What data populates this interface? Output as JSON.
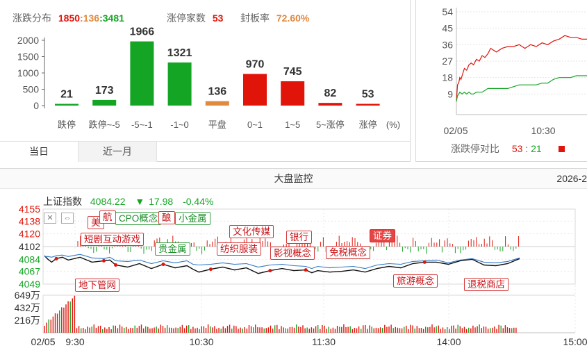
{
  "breadth": {
    "label_distribution": "涨跌分布",
    "up_count": "1850",
    "sep1": ":",
    "flat_count": "136",
    "sep2": ":",
    "down_count": "3481",
    "label_limit_up": "涨停家数",
    "limit_up_count": "53",
    "label_seal_rate": "封板率",
    "seal_rate": "72.60%",
    "unit_label": "(%)",
    "tabs": [
      {
        "label": "当日"
      },
      {
        "label": "近一月"
      }
    ]
  },
  "ratio": {
    "label": "涨跌停对比",
    "up_count": "53",
    "sep": ":",
    "down_count": "21"
  },
  "monitor": {
    "title": "大盘监控",
    "date": "2026-2",
    "index_name": "上证指数",
    "index_value": "4084.22",
    "change_arrow": "▼",
    "change": "17.98",
    "change_pct": "-0.44%",
    "tags": [
      {
        "text": "美",
        "kind": "r"
      },
      {
        "text": "航",
        "kind": "r"
      },
      {
        "text": "CPO概念",
        "kind": "g"
      },
      {
        "text": "酿",
        "kind": "r"
      },
      {
        "text": "小金属",
        "kind": "g"
      },
      {
        "text": "短剧互动游戏",
        "kind": "r"
      },
      {
        "text": "贵金属",
        "kind": "g"
      },
      {
        "text": "文化传媒",
        "kind": "r"
      },
      {
        "text": "纺织服装",
        "kind": "r"
      },
      {
        "text": "银行",
        "kind": "r"
      },
      {
        "text": "影视概念",
        "kind": "r"
      },
      {
        "text": "证券",
        "kind": "sel"
      },
      {
        "text": "免税概念",
        "kind": "r"
      },
      {
        "text": "地下管网",
        "kind": "r"
      },
      {
        "text": "旅游概念",
        "kind": "r"
      },
      {
        "text": "退税商店",
        "kind": "r"
      }
    ],
    "y_ticks": [
      "4155",
      "4138",
      "4120",
      "4102",
      "4084",
      "4067",
      "4049"
    ],
    "vol_ticks": [
      "649万",
      "432万",
      "216万"
    ],
    "x_ticks": [
      "02/05",
      "9:30",
      "10:30",
      "11:30",
      "14:00",
      "15:00"
    ]
  },
  "colors": {
    "up": "#e1140a",
    "down": "#15a525",
    "flat": "#e0893f",
    "price_line": "#111111",
    "avg_line": "#2f78c4"
  },
  "chart_data": [
    {
      "type": "bar",
      "title": "",
      "categories": [
        "跌停",
        "跌停~-5",
        "-5~-1",
        "-1~0",
        "平盘",
        "0~1",
        "1~5",
        "5~涨停",
        "涨停"
      ],
      "values": [
        21,
        173,
        1966,
        1321,
        136,
        970,
        745,
        82,
        53
      ],
      "bar_colors": [
        "#15a525",
        "#15a525",
        "#15a525",
        "#15a525",
        "#e0893f",
        "#e1140a",
        "#e1140a",
        "#e1140a",
        "#e1140a"
      ],
      "y_ticks": [
        0,
        500,
        1000,
        1500,
        2000
      ],
      "ylim": [
        0,
        2000
      ],
      "xlabel": "",
      "ylabel": ""
    },
    {
      "type": "line",
      "title": "",
      "x_ticks": [
        "02/05",
        "10:30"
      ],
      "y_ticks": [
        9,
        18,
        27,
        36,
        45,
        54
      ],
      "ylim": [
        0,
        54
      ],
      "series": [
        {
          "color": "#e1140a",
          "x": [
            0,
            2,
            4,
            6,
            8,
            10,
            14,
            18,
            22,
            26,
            30,
            35,
            40,
            45,
            50,
            55,
            60,
            70,
            80,
            90,
            100,
            110,
            120,
            130,
            140,
            150,
            160,
            170,
            180,
            190,
            200,
            210,
            220,
            230
          ],
          "values": [
            5,
            14,
            15,
            18,
            17,
            19,
            23,
            22,
            25,
            26,
            25,
            28,
            27,
            30,
            29,
            31,
            34,
            32,
            34,
            35,
            35,
            36,
            34,
            36,
            35,
            37,
            36,
            38,
            39,
            41,
            40,
            40,
            39,
            39
          ]
        },
        {
          "color": "#15a525",
          "x": [
            0,
            2,
            4,
            6,
            10,
            14,
            18,
            22,
            26,
            30,
            35,
            40,
            45,
            50,
            55,
            60,
            70,
            80,
            90,
            100,
            110,
            120,
            130,
            140,
            150,
            160,
            170,
            180,
            190,
            200,
            210,
            220,
            230
          ],
          "values": [
            5,
            8,
            9,
            10,
            9,
            10,
            9,
            10,
            9,
            9,
            10,
            10,
            10,
            11,
            12,
            12,
            12,
            12,
            12,
            13,
            14,
            14,
            14,
            14,
            15,
            15,
            17,
            18,
            18,
            18,
            19,
            19,
            19
          ]
        }
      ]
    },
    {
      "type": "line",
      "title": "上证指数",
      "x_ticks": [
        "02/05",
        "9:30",
        "10:30",
        "11:30",
        "14:00",
        "15:00"
      ],
      "ylim": [
        4049,
        4155
      ],
      "y_ticks": [
        4155,
        4138,
        4120,
        4102,
        4084,
        4067,
        4049
      ],
      "series": [
        {
          "color": "#111111",
          "x": [
            0,
            3,
            6,
            10,
            15,
            20,
            30,
            40,
            50,
            55,
            60,
            70,
            80,
            90,
            100,
            110,
            120,
            125,
            130,
            140,
            150,
            160,
            170,
            180,
            190,
            200,
            210,
            220,
            225,
            230,
            240,
            250,
            260,
            270,
            280,
            290,
            300,
            310,
            320,
            330,
            340,
            350,
            360,
            370,
            380,
            390,
            400
          ],
          "values": [
            4089,
            4084,
            4080,
            4085,
            4087,
            4083,
            4087,
            4080,
            4082,
            4083,
            4076,
            4073,
            4078,
            4071,
            4077,
            4072,
            4075,
            4070,
            4066,
            4070,
            4073,
            4069,
            4072,
            4064,
            4068,
            4071,
            4068,
            4069,
            4065,
            4068,
            4066,
            4067,
            4069,
            4066,
            4071,
            4074,
            4072,
            4078,
            4080,
            4080,
            4077,
            4082,
            4084,
            4076,
            4075,
            4078,
            4085
          ]
        },
        {
          "color": "#2f78c4",
          "x": [
            0,
            3,
            6,
            10,
            15,
            20,
            30,
            40,
            50,
            55,
            60,
            70,
            80,
            90,
            100,
            110,
            120,
            125,
            130,
            140,
            150,
            160,
            170,
            180,
            190,
            200,
            210,
            220,
            225,
            230,
            240,
            250,
            260,
            270,
            280,
            290,
            300,
            310,
            320,
            330,
            340,
            350,
            360,
            370,
            380,
            390,
            400
          ],
          "values": [
            4088,
            4088,
            4087,
            4089,
            4090,
            4088,
            4091,
            4086,
            4085,
            4087,
            4082,
            4081,
            4083,
            4078,
            4082,
            4079,
            4082,
            4077,
            4076,
            4077,
            4079,
            4077,
            4078,
            4073,
            4076,
            4077,
            4075,
            4074,
            4071,
            4074,
            4072,
            4073,
            4074,
            4071,
            4076,
            4078,
            4077,
            4081,
            4082,
            4083,
            4079,
            4083,
            4085,
            4080,
            4079,
            4081,
            4086
          ]
        }
      ],
      "volume": {
        "unit": "万",
        "ylim": [
          0,
          649
        ],
        "y_ticks": [
          649,
          432,
          216
        ]
      }
    }
  ]
}
